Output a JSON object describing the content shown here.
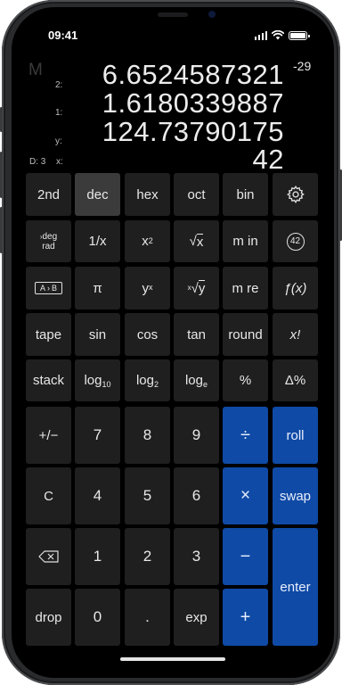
{
  "status": {
    "time": "09:41"
  },
  "display": {
    "memory_indicator": "M",
    "registers": [
      {
        "label": "2:",
        "value": "6.6524587321"
      },
      {
        "label": "1:",
        "value": "1.6180339887"
      },
      {
        "label": "y:",
        "value": "124.73790175"
      },
      {
        "label": "",
        "value": "42"
      }
    ],
    "exponent": "-29",
    "stack_depth": "D: 3",
    "x_label": "x:"
  },
  "keys": {
    "row1": [
      "2nd",
      "dec",
      "hex",
      "oct",
      "bin",
      "gear-icon"
    ],
    "deg_top": "deg",
    "deg_bottom": "rad",
    "reciprocal": "1/x",
    "square_base": "x",
    "square_exp": "2",
    "sqrt_symbol": "√",
    "sqrt_var": "x",
    "mem_in": "m in",
    "answer": "42",
    "swap_a": "A",
    "swap_b": "B",
    "pi": "π",
    "ypow_base": "y",
    "ypow_exp": "x",
    "xroot_index": "x",
    "xroot_symbol": "√",
    "xroot_var": "y",
    "mem_recall": "m re",
    "func": "ƒ(x)",
    "tape": "tape",
    "sin": "sin",
    "cos": "cos",
    "tan": "tan",
    "round": "round",
    "factorial": "x!",
    "stack": "stack",
    "log10_base": "log",
    "log10_sub": "10",
    "log2_base": "log",
    "log2_sub": "2",
    "loge_base": "log",
    "loge_sub": "e",
    "percent": "%",
    "delta_percent": "Δ%",
    "plus_minus": "+/−",
    "d7": "7",
    "d8": "8",
    "d9": "9",
    "divide": "÷",
    "roll": "roll",
    "clear": "C",
    "d4": "4",
    "d5": "5",
    "d6": "6",
    "multiply": "×",
    "swap": "swap",
    "d1": "1",
    "d2": "2",
    "d3": "3",
    "minus": "−",
    "enter": "enter",
    "drop": "drop",
    "d0": "0",
    "dot": ".",
    "exp": "exp",
    "plus": "+"
  },
  "colors": {
    "accent_blue": "#0f4aa6",
    "key_bg": "#1f1f20",
    "selected_key_bg": "#3b3b3c"
  }
}
